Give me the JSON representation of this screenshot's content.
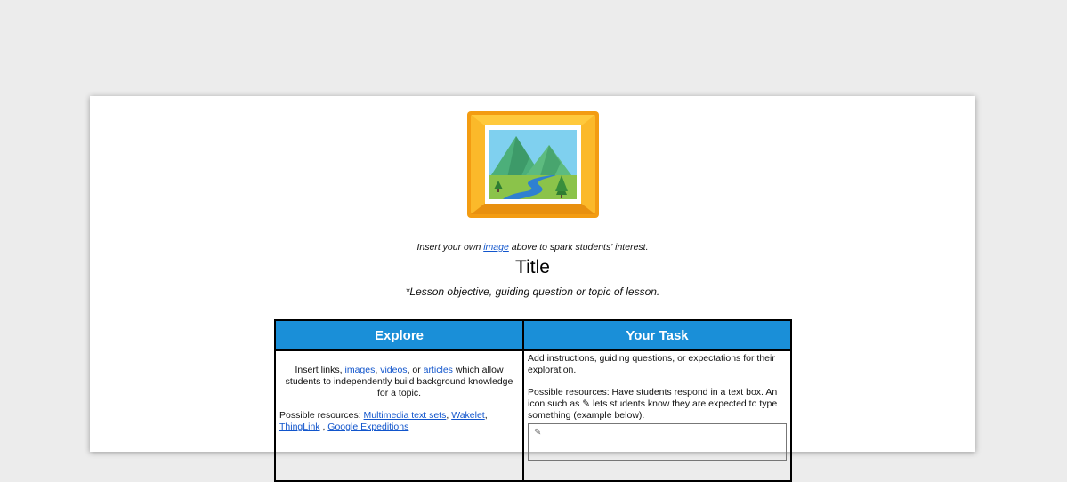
{
  "caption": {
    "before": "Insert your own ",
    "link": "image",
    "after": " above to spark students' interest."
  },
  "title": "Title",
  "objective": "*Lesson objective, guiding question or topic of lesson.",
  "table": {
    "headers": [
      "Explore",
      "Your Task"
    ],
    "explore": {
      "intro_before": "Insert links, ",
      "links": [
        "images",
        "videos",
        "articles"
      ],
      "sep1": ", ",
      "sep2": ", or ",
      "intro_after": " which allow students to independently build background knowledge for a topic.",
      "resources_label": "Possible resources: ",
      "resources": [
        "Multimedia text sets",
        "Wakelet",
        "ThingLink",
        "Google Expeditions"
      ],
      "res_sep1": ", ",
      "res_sep2": ", ",
      "res_sep3": " , "
    },
    "task": {
      "para1": "Add instructions, guiding questions, or expectations for their exploration.",
      "para2": "Possible resources:  Have students respond in a text box. An icon such as ✎ lets students know they are expected to type something (example below)."
    }
  },
  "icons": {
    "image_placeholder": "framed-landscape-icon",
    "pencil": "pencil-icon"
  },
  "colors": {
    "header_blue": "#1a8fd8",
    "link_blue": "#1155cc",
    "frame_orange": "#f5a623"
  }
}
